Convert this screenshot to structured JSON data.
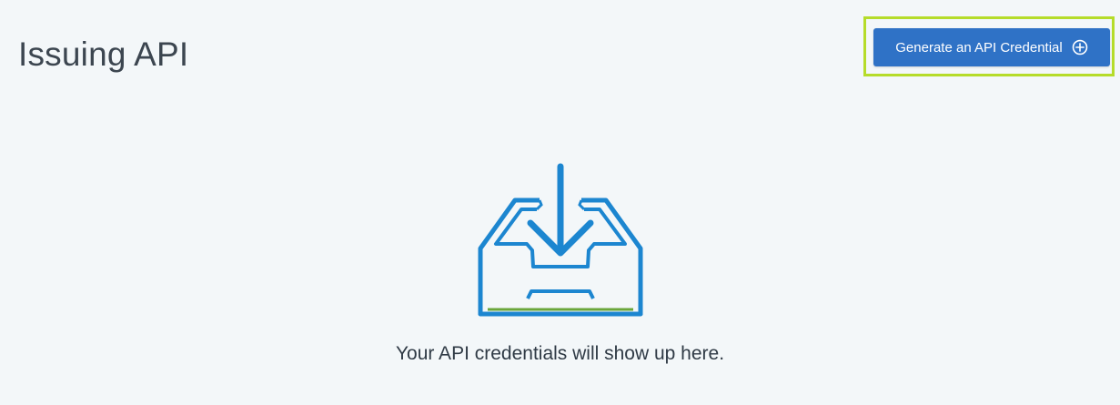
{
  "header": {
    "title": "Issuing API"
  },
  "toolbar": {
    "generate_label": "Generate an API Credential",
    "generate_icon": "plus-circle-icon"
  },
  "empty_state": {
    "icon": "inbox-download-icon",
    "message": "Your API credentials will show up here."
  },
  "colors": {
    "background": "#f3f7f9",
    "button": "#2f72c6",
    "highlight": "#b5dc2a",
    "illustration": "#1c86d0",
    "illustration_accent": "#6aa63a"
  }
}
